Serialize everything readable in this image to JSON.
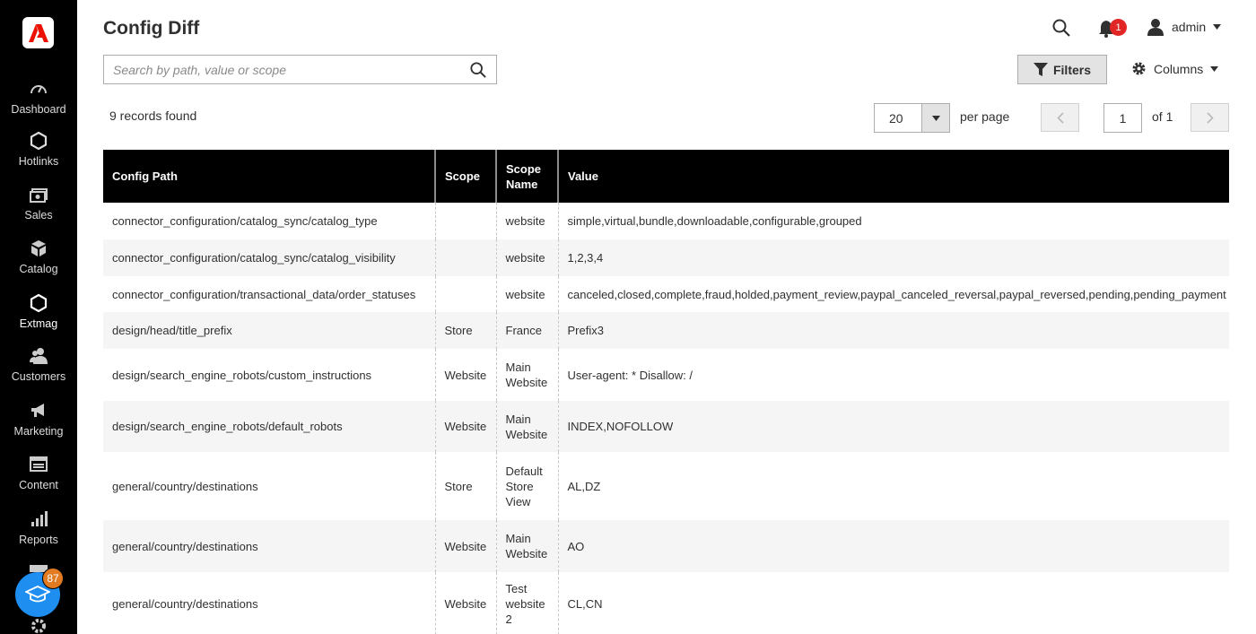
{
  "app": {
    "title": "Config Diff"
  },
  "sidebar": {
    "items": [
      {
        "label": "Dashboard",
        "icon": "dashboard-icon"
      },
      {
        "label": "Hotlinks",
        "icon": "hexagon-icon"
      },
      {
        "label": "Sales",
        "icon": "sales-icon"
      },
      {
        "label": "Catalog",
        "icon": "catalog-icon"
      },
      {
        "label": "Extmag",
        "icon": "hexagon-icon"
      },
      {
        "label": "Customers",
        "icon": "customers-icon"
      },
      {
        "label": "Marketing",
        "icon": "megaphone-icon"
      },
      {
        "label": "Content",
        "icon": "content-icon"
      },
      {
        "label": "Reports",
        "icon": "reports-icon"
      }
    ],
    "learning_badge": "87"
  },
  "header": {
    "notifications_count": "1",
    "user": "admin"
  },
  "search": {
    "placeholder": "Search by path, value or scope",
    "value": ""
  },
  "toolbar": {
    "filters_label": "Filters",
    "columns_label": "Columns",
    "records_found": "9 records found",
    "per_page": "20",
    "per_page_label": "per page",
    "page": "1",
    "of_pages": "of 1"
  },
  "table": {
    "columns": [
      "Config Path",
      "Scope",
      "Scope Name",
      "Value"
    ],
    "rows": [
      [
        "connector_configuration/catalog_sync/catalog_type",
        "",
        "website",
        "simple,virtual,bundle,downloadable,configurable,grouped"
      ],
      [
        "connector_configuration/catalog_sync/catalog_visibility",
        "",
        "website",
        "1,2,3,4"
      ],
      [
        "connector_configuration/transactional_data/order_statuses",
        "",
        "website",
        "canceled,closed,complete,fraud,holded,payment_review,paypal_canceled_reversal,paypal_reversed,pending,pending_payment"
      ],
      [
        "design/head/title_prefix",
        "Store",
        "France",
        "Prefix3"
      ],
      [
        "design/search_engine_robots/custom_instructions",
        "Website",
        "Main Website",
        "User-agent: * Disallow: /"
      ],
      [
        "design/search_engine_robots/default_robots",
        "Website",
        "Main Website",
        "INDEX,NOFOLLOW"
      ],
      [
        "general/country/destinations",
        "Store",
        "Default Store View",
        "AL,DZ"
      ],
      [
        "general/country/destinations",
        "Website",
        "Main Website",
        "AO"
      ],
      [
        "general/country/destinations",
        "Website",
        "Test website 2",
        "CL,CN"
      ]
    ]
  },
  "colors": {
    "sidebar_bg": "#000000",
    "header_bg": "#000000",
    "accent_red": "#eb1000",
    "badge_orange": "#e27a21",
    "learn_blue": "#1f8ef1"
  }
}
